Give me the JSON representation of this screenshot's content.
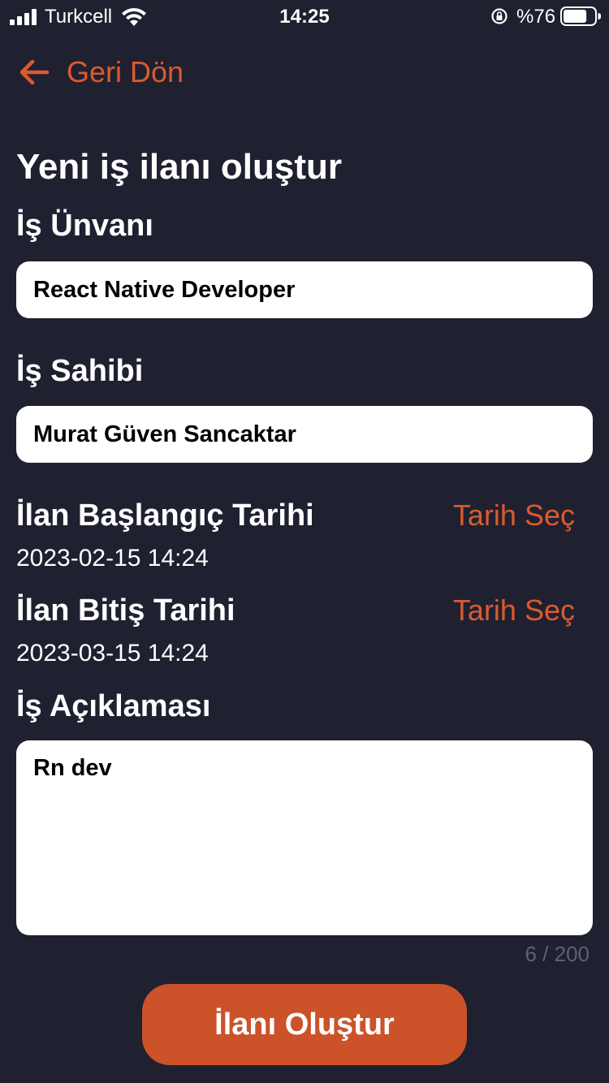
{
  "status_bar": {
    "carrier": "Turkcell",
    "time": "14:25",
    "battery_percent": "%76",
    "battery_level": 0.76,
    "icons": [
      "signal-icon",
      "wifi-icon",
      "rotation-lock-icon",
      "battery-icon"
    ]
  },
  "nav": {
    "back_label": "Geri Dön",
    "back_icon": "arrow-left-icon"
  },
  "page": {
    "title": "Yeni iş ilanı oluştur"
  },
  "form": {
    "job_title": {
      "label": "İş Ünvanı",
      "value": "React Native Developer"
    },
    "employer": {
      "label": "İş Sahibi",
      "value": "Murat Güven Sancaktar"
    },
    "start_date": {
      "label": "İlan Başlangıç Tarihi",
      "picker_label": "Tarih Seç",
      "value": "2023-02-15 14:24"
    },
    "end_date": {
      "label": "İlan Bitiş Tarihi",
      "picker_label": "Tarih Seç",
      "value": "2023-03-15 14:24"
    },
    "description": {
      "label": "İş Açıklaması",
      "value": "Rn dev",
      "counter": "6 / 200"
    },
    "submit_label": "İlanı Oluştur"
  },
  "colors": {
    "background": "#1f2130",
    "accent": "#dc5a2e",
    "button": "#cc5229",
    "input_bg": "#ffffff"
  }
}
